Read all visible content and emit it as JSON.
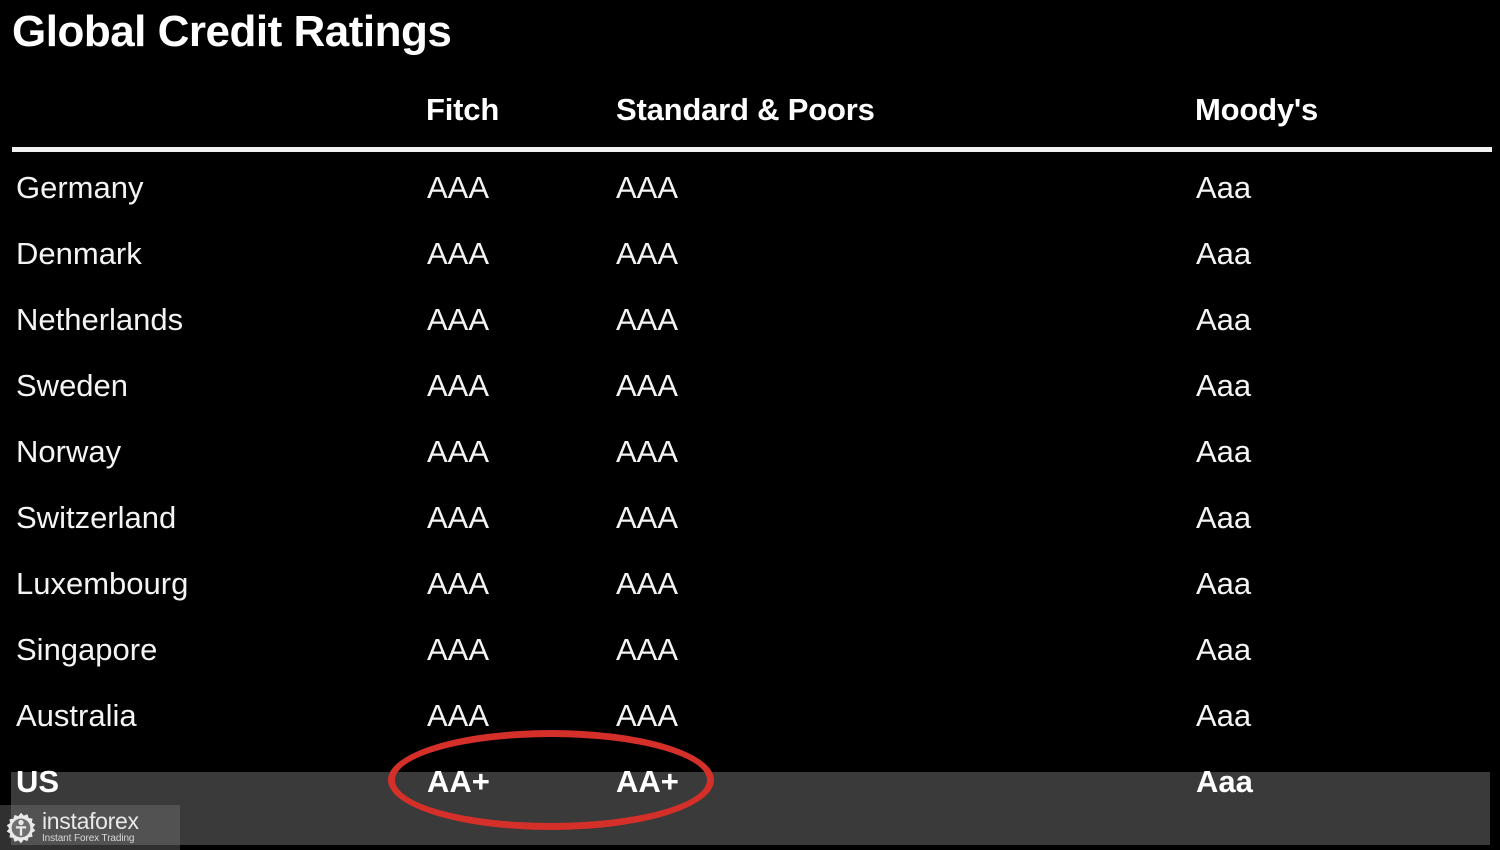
{
  "title": "Global Credit Ratings",
  "table": {
    "columns": {
      "country": "",
      "fitch": "Fitch",
      "sp": "Standard & Poors",
      "moodys": "Moody's"
    },
    "rows": [
      {
        "country": "Germany",
        "fitch": "AAA",
        "sp": "AAA",
        "moodys": "Aaa"
      },
      {
        "country": "Denmark",
        "fitch": "AAA",
        "sp": "AAA",
        "moodys": "Aaa"
      },
      {
        "country": "Netherlands",
        "fitch": "AAA",
        "sp": "AAA",
        "moodys": "Aaa"
      },
      {
        "country": "Sweden",
        "fitch": "AAA",
        "sp": "AAA",
        "moodys": "Aaa"
      },
      {
        "country": "Norway",
        "fitch": "AAA",
        "sp": "AAA",
        "moodys": "Aaa"
      },
      {
        "country": "Switzerland",
        "fitch": "AAA",
        "sp": "AAA",
        "moodys": "Aaa"
      },
      {
        "country": "Luxembourg",
        "fitch": "AAA",
        "sp": "AAA",
        "moodys": "Aaa"
      },
      {
        "country": "Singapore",
        "fitch": "AAA",
        "sp": "AAA",
        "moodys": "Aaa"
      },
      {
        "country": "Australia",
        "fitch": "AAA",
        "sp": "AAA",
        "moodys": "Aaa"
      },
      {
        "country": "US",
        "fitch": "AA+",
        "sp": "AA+",
        "moodys": "Aaa",
        "highlight": true
      }
    ]
  },
  "annotation": {
    "shape": "ellipse",
    "color": "#d42f28",
    "targets": [
      "US Fitch AA+",
      "US Standard & Poors AA+"
    ]
  },
  "watermark": {
    "name": "instaforex",
    "tagline": "Instant Forex Trading",
    "icon": "instaforex-gear-logo-icon"
  },
  "colors": {
    "background": "#000000",
    "text": "#f4f4f4",
    "rule": "#f2f2f2",
    "highlight_row": "#3a3a3a",
    "annotation_red": "#d42f28"
  }
}
